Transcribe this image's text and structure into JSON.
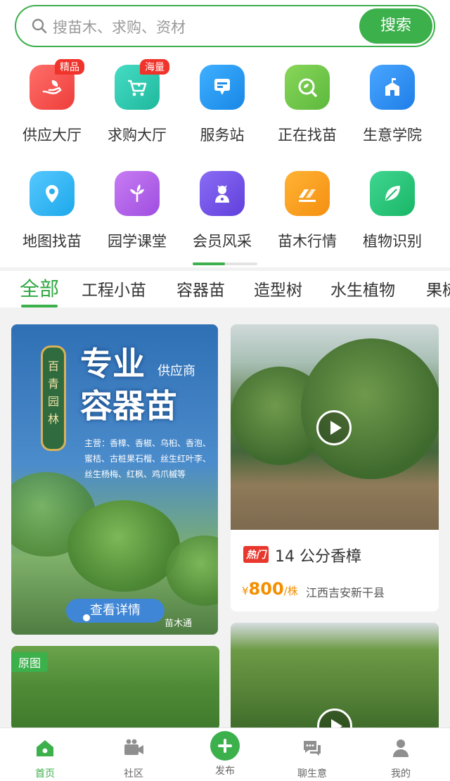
{
  "search": {
    "placeholder": "搜苗木、求购、资材",
    "button": "搜索"
  },
  "grid": [
    {
      "label": "供应大厅",
      "badge": "精品",
      "icon": "hand-leaf-icon",
      "color": "#f2504c"
    },
    {
      "label": "求购大厅",
      "badge": "海量",
      "icon": "cart-icon",
      "color": "#2ec9b0"
    },
    {
      "label": "服务站",
      "badge": "",
      "icon": "station-icon",
      "color": "#1f9bf0"
    },
    {
      "label": "正在找苗",
      "badge": "",
      "icon": "search-leaf-icon",
      "color": "#6cc54a"
    },
    {
      "label": "生意学院",
      "badge": "",
      "icon": "school-icon",
      "color": "#2f8ef0"
    },
    {
      "label": "地图找苗",
      "badge": "",
      "icon": "map-pin-icon",
      "color": "#29b6f0"
    },
    {
      "label": "园学课堂",
      "badge": "",
      "icon": "sprout-icon",
      "color": "#b15ee8"
    },
    {
      "label": "会员风采",
      "badge": "",
      "icon": "member-icon",
      "color": "#7451e6"
    },
    {
      "label": "苗木行情",
      "badge": "",
      "icon": "trend-icon",
      "color": "#f7a21b"
    },
    {
      "label": "植物识别",
      "badge": "",
      "icon": "leaf-icon",
      "color": "#27c47a"
    }
  ],
  "tabs": [
    "全部",
    "工程小苗",
    "容器苗",
    "造型树",
    "水生植物",
    "果树"
  ],
  "poster": {
    "plaque": "百\n青\n园\n林",
    "line1": "专业",
    "line2": "容器苗",
    "supplier": "供应商",
    "desc": "主营：香樟、香椒、乌桕、香泡、蜜桔、古桩果石榴、丝生红叶李、丝生杨梅、红枫、鸡爪槭等",
    "cta": "查看详情",
    "logo": "苗木通"
  },
  "video_card": {
    "hot": "热门",
    "title": "14 公分香樟",
    "currency": "¥",
    "price": "800",
    "unit": "/株",
    "location": "江西吉安新干县"
  },
  "photo_card": {
    "tag": "原图"
  },
  "nav": [
    {
      "label": "首页",
      "icon": "home-icon",
      "active": true
    },
    {
      "label": "社区",
      "icon": "video-icon",
      "active": false
    },
    {
      "label": "发布",
      "icon": "plus-icon",
      "active": false
    },
    {
      "label": "聊生意",
      "icon": "chat-icon",
      "active": false
    },
    {
      "label": "我的",
      "icon": "profile-icon",
      "active": false
    }
  ]
}
